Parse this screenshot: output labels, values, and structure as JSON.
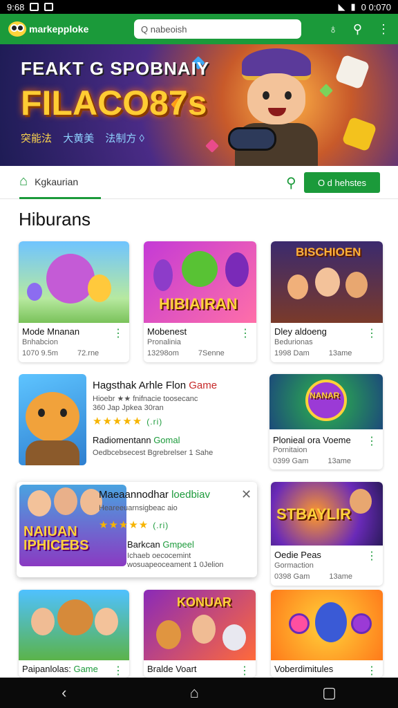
{
  "status": {
    "time": "9:68",
    "right": "0 0:070"
  },
  "appbar": {
    "brand": "markepploke",
    "search_placeholder": "Q nabeoish"
  },
  "banner": {
    "line1": "FEAKT G SPOBNAIY",
    "line2": "FILACO87s",
    "line3a": "突能法",
    "line3b": "大黄美",
    "line3c": "法制方 ◊"
  },
  "tabs": {
    "active_label": "Kgkaurian",
    "cta_label": "O  d hehstes"
  },
  "section_title": "Hiburans",
  "cards": {
    "a": {
      "name": "Mode Mnanan",
      "sub": "Bnhabcion",
      "meta1": "1070 9.5m",
      "meta2": "72.rne"
    },
    "b": {
      "name": "Mobenest",
      "sub": "Pronalinia",
      "meta1": "13298om",
      "meta2": "7Senne",
      "thumb_text": "HIBIAIRAN"
    },
    "c": {
      "name": "Dley aldoeng",
      "sub": "Bedurionas",
      "meta1": "1998 Dam",
      "meta2": "13ame",
      "thumb_text": "BISCHIOEN"
    },
    "d": {
      "name": "Plonieal ora Voeme",
      "sub": "Pornitaion",
      "meta1": "0399 Gam",
      "meta2": "13ame",
      "thumb_text": "NANAR"
    },
    "e": {
      "name": "Oedie Peas",
      "sub": "Gormaction",
      "meta1": "0398 Gam",
      "meta2": "13ame",
      "thumb_text": "STBAYLIR"
    },
    "f": {
      "name": "Paipanlolas:",
      "name_green": "Game"
    },
    "g": {
      "name": "Bralde Voart",
      "thumb_text": "KONUAR"
    },
    "h": {
      "name": "Voberdimitules"
    }
  },
  "wide1": {
    "title": "Hagsthak Arhle Flon",
    "title_red": "Game",
    "line1": "Hioebr ★★ fnifnacie toosecanc",
    "line2": "360 Jap Jpkea 30ran",
    "stars": "★★★★★",
    "rating": "(.ri)",
    "line3": "Radiomentann",
    "line3_green": "Gomal",
    "line4": "Oedbcebsecest  Bgrebrelser 1 Sahe"
  },
  "wide2": {
    "title": "Maeaannodhar",
    "title_green": "loedbiav",
    "line1": "Heareeuarnsigbeac aio",
    "stars": "★★★★★",
    "rating": "(.ri)",
    "line3": "Barkcan",
    "line3_green": "Gmpeel",
    "line4": "Ichaeb  oecocemint",
    "line5": "wosuapeoceament 1 0Jelion",
    "thumb_text": "NAIUAN IPHICEBS"
  },
  "nav": {
    "back": "‹",
    "home": "⌂",
    "recents": "▢"
  },
  "colors": {
    "accent": "#1b9a3a",
    "red": "#c62828",
    "star": "#f6b400"
  }
}
